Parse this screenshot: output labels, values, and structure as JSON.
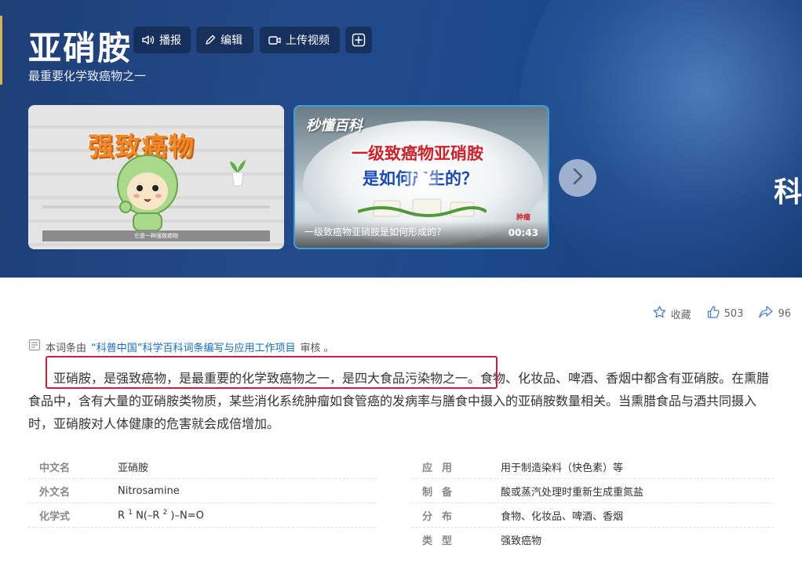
{
  "header": {
    "title": "亚硝胺",
    "subtitle": "最重要化学致癌物之一",
    "buttons": {
      "play": "播报",
      "edit": "编辑",
      "upload": "上传视频"
    },
    "edge_text": "科"
  },
  "media": {
    "card1": {
      "overlay_text": "强致癌物",
      "caption": "它是一种强致癌物"
    },
    "card2": {
      "logo": "秒懂百科",
      "line1": "一级致癌物亚硝胺",
      "line2": "是如何产生的？",
      "caption": "一级致癌物亚硝胺是如何形成的？",
      "duration": "00:43",
      "stamp": "肿瘤"
    }
  },
  "actions": {
    "collect": "收藏",
    "likes": "503",
    "shares": "96"
  },
  "source": {
    "prefix": "本词条由",
    "link": "“科普中国”科学百科词条编写与应用工作项目",
    "suffix": "审核 。"
  },
  "intro": "亚硝胺，是强致癌物，是最重要的化学致癌物之一，是四大食品污染物之一。食物、化妆品、啤酒、香烟中都含有亚硝胺。在熏腊食品中，含有大量的亚硝胺类物质，某些消化系统肿瘤如食管癌的发病率与膳食中摄入的亚硝胺数量相关。当熏腊食品与酒共同摄入时，亚硝胺对人体健康的危害就会成倍增加。",
  "basic_info": {
    "left": [
      {
        "name": "中文名",
        "value": "亚硝胺"
      },
      {
        "name": "外文名",
        "value": "Nitrosamine"
      },
      {
        "name": "化学式",
        "formula": {
          "r": "R",
          "sup1": "1",
          "mid": "N(–R",
          "sup2": "2",
          "end": ")–N=O"
        }
      }
    ],
    "right": [
      {
        "name": "应用",
        "value": "用于制造染料（快色素）等"
      },
      {
        "name": "制备",
        "value": "酸或蒸汽处理时重新生成重氮盐"
      },
      {
        "name": "分布",
        "value": "食物、化妆品、啤酒、香烟"
      },
      {
        "name": "类型",
        "value": "强致癌物"
      }
    ]
  },
  "colors": {
    "banner": "#234a88",
    "link": "#136ec2",
    "highlight_border": "#c8213f"
  }
}
